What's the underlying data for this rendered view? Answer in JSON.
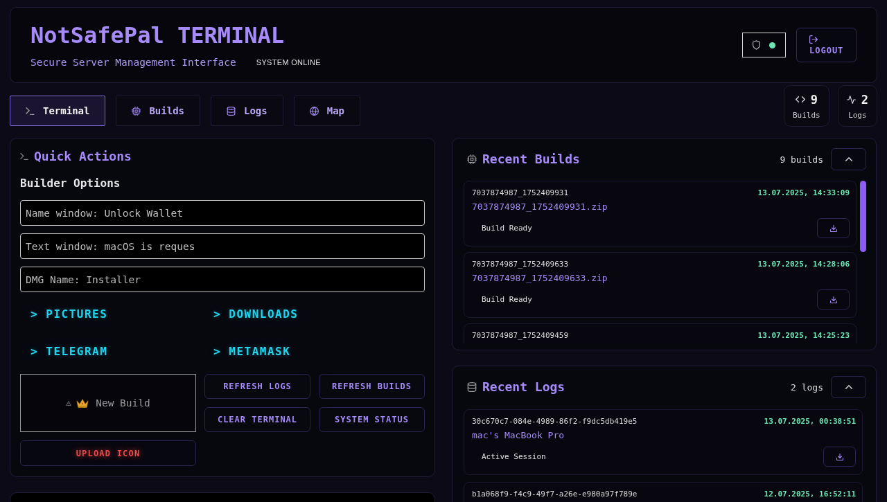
{
  "header": {
    "title": "NotSafePal TERMINAL",
    "subtitle": "Secure Server Management Interface",
    "status": "SYSTEM ONLINE",
    "connected": true,
    "logout": "LOGOUT"
  },
  "tabs": [
    {
      "label": "Terminal",
      "selected": true
    },
    {
      "label": "Builds",
      "selected": false
    },
    {
      "label": "Logs",
      "selected": false
    },
    {
      "label": "Map",
      "selected": false
    }
  ],
  "stats": [
    {
      "value": "9",
      "label": "Builds"
    },
    {
      "value": "2",
      "label": "Logs"
    }
  ],
  "quick_actions": {
    "title": "Quick Actions",
    "section": "Builder Options",
    "fields": [
      {
        "value": "Name window: Unlock Wallet"
      },
      {
        "value": "Text window: macOS is reques"
      },
      {
        "value": "DMG Name: Installer"
      }
    ],
    "options": [
      "> PICTURES",
      "> DOWNLOADS",
      "> TELEGRAM",
      "> METAMASK"
    ],
    "new_build": "New Build",
    "upload": "UPLOAD ICON",
    "actions": [
      "REFRESH LOGS",
      "REFRESH BUILDS",
      "CLEAR TERMINAL",
      "SYSTEM STATUS"
    ]
  },
  "builds_panel": {
    "title": "Recent Builds",
    "count": "9 builds",
    "expanded": true,
    "items": [
      {
        "id": "7037874987_1752409931",
        "time": "13.07.2025, 14:33:09",
        "file": "7037874987_1752409931.zip",
        "status": "Build Ready"
      },
      {
        "id": "7037874987_1752409633",
        "time": "13.07.2025, 14:28:06",
        "file": "7037874987_1752409633.zip",
        "status": "Build Ready"
      },
      {
        "id": "7037874987_1752409459",
        "time": "13.07.2025, 14:25:23"
      }
    ]
  },
  "logs_panel": {
    "title": "Recent Logs",
    "count": "2 logs",
    "expanded": true,
    "items": [
      {
        "id": "30c670c7-084e-4989-86f2-f9dc5db419e5",
        "time": "13.07.2025, 00:38:51",
        "device": "mac's MacBook Pro",
        "status": "Active Session"
      },
      {
        "id": "b1a068f9-f4c9-49f7-a26e-e980a97f789e",
        "time": "12.07.2025, 16:52:11"
      }
    ]
  }
}
